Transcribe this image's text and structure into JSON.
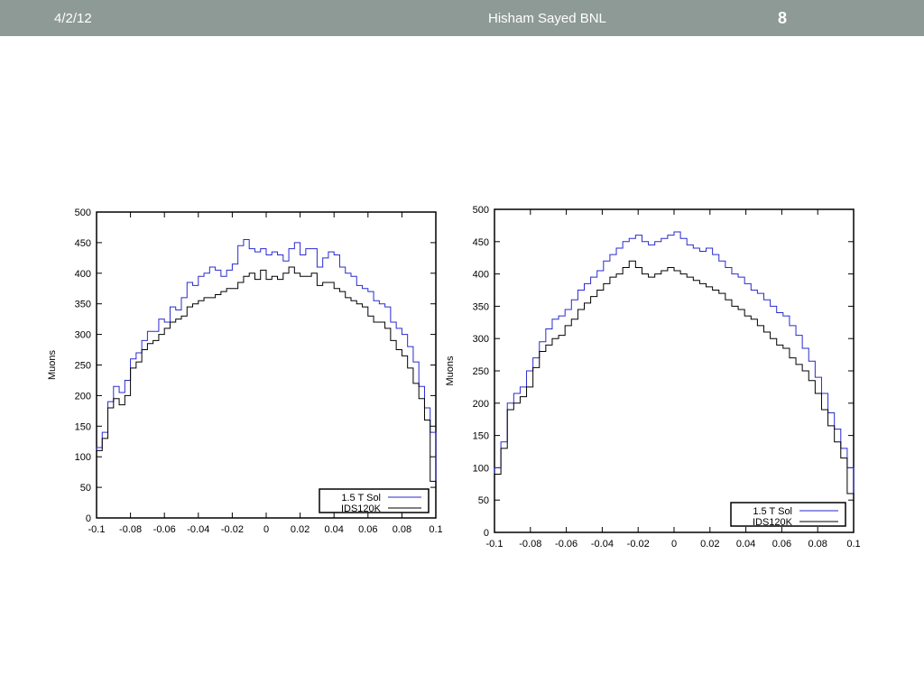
{
  "header": {
    "date": "4/2/12",
    "author": "Hisham Sayed BNL",
    "page_number": "8"
  },
  "chart_data": [
    {
      "type": "line",
      "style": "step-histogram",
      "ylabel": "Muons",
      "xlim": [
        -0.1,
        0.1
      ],
      "ylim": [
        0,
        500
      ],
      "x_ticks": [
        "-0.1",
        "-0.08",
        "-0.06",
        "-0.04",
        "-0.02",
        "0",
        "0.02",
        "0.04",
        "0.06",
        "0.08",
        "0.1"
      ],
      "y_ticks": [
        "0",
        "50",
        "100",
        "150",
        "200",
        "250",
        "300",
        "350",
        "400",
        "450",
        "500"
      ],
      "legend_position": "bottom-right",
      "series": [
        {
          "name": "1.5 T Sol",
          "color": "#2a2acf",
          "values": [
            115,
            140,
            190,
            215,
            205,
            225,
            260,
            270,
            290,
            305,
            305,
            325,
            320,
            345,
            340,
            360,
            385,
            380,
            395,
            400,
            410,
            405,
            395,
            405,
            415,
            445,
            455,
            440,
            435,
            440,
            430,
            435,
            430,
            420,
            440,
            450,
            430,
            440,
            440,
            410,
            425,
            435,
            430,
            410,
            400,
            395,
            380,
            375,
            370,
            355,
            350,
            345,
            320,
            310,
            300,
            280,
            255,
            215,
            180,
            140
          ]
        },
        {
          "name": "IDS120K",
          "color": "#000000",
          "values": [
            110,
            130,
            180,
            195,
            185,
            200,
            245,
            255,
            275,
            285,
            290,
            300,
            310,
            320,
            325,
            330,
            345,
            350,
            355,
            360,
            360,
            365,
            370,
            375,
            375,
            385,
            395,
            400,
            390,
            405,
            390,
            395,
            390,
            400,
            410,
            400,
            395,
            395,
            400,
            380,
            385,
            385,
            375,
            370,
            360,
            355,
            350,
            345,
            330,
            320,
            320,
            310,
            290,
            275,
            265,
            245,
            220,
            195,
            160,
            60
          ]
        }
      ]
    },
    {
      "type": "line",
      "style": "step-histogram",
      "ylabel": "Muons",
      "xlim": [
        -0.1,
        0.1
      ],
      "ylim": [
        0,
        500
      ],
      "x_ticks": [
        "-0.1",
        "-0.08",
        "-0.06",
        "-0.04",
        "-0.02",
        "0",
        "0.02",
        "0.04",
        "0.06",
        "0.08",
        "0.1"
      ],
      "y_ticks": [
        "0",
        "50",
        "100",
        "150",
        "200",
        "250",
        "300",
        "350",
        "400",
        "450",
        "500"
      ],
      "legend_position": "bottom-right",
      "series": [
        {
          "name": "1.5 T Sol",
          "color": "#2a2acf",
          "values": [
            100,
            140,
            200,
            215,
            225,
            250,
            270,
            295,
            315,
            330,
            335,
            345,
            360,
            375,
            385,
            395,
            405,
            420,
            430,
            440,
            450,
            455,
            460,
            450,
            445,
            450,
            455,
            460,
            465,
            455,
            445,
            440,
            435,
            440,
            430,
            420,
            410,
            400,
            395,
            385,
            375,
            370,
            360,
            350,
            340,
            335,
            320,
            305,
            285,
            265,
            240,
            215,
            185,
            160,
            130,
            100
          ]
        },
        {
          "name": "IDS120K",
          "color": "#000000",
          "values": [
            90,
            130,
            190,
            200,
            210,
            225,
            255,
            280,
            290,
            300,
            305,
            320,
            330,
            345,
            355,
            365,
            375,
            385,
            395,
            400,
            410,
            420,
            410,
            400,
            395,
            400,
            405,
            410,
            405,
            400,
            395,
            390,
            385,
            380,
            375,
            370,
            360,
            350,
            345,
            335,
            330,
            320,
            310,
            300,
            290,
            285,
            270,
            260,
            250,
            235,
            215,
            190,
            165,
            140,
            115,
            60
          ]
        }
      ]
    }
  ]
}
